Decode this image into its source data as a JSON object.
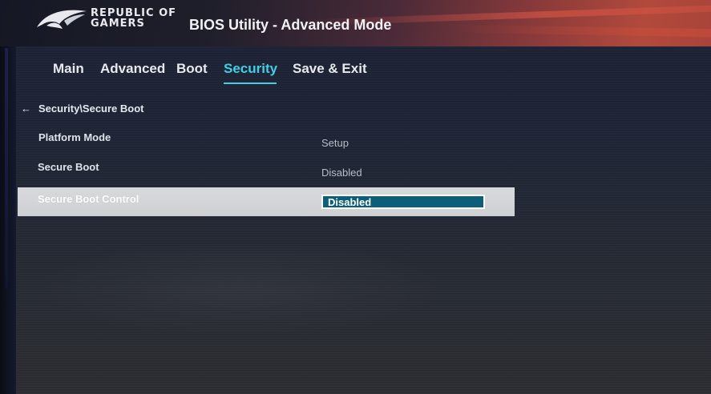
{
  "header": {
    "brand_line1": "REPUBLIC OF",
    "brand_line2": "GAMERS",
    "title": "BIOS Utility - Advanced Mode",
    "logo_icon": "rog-eye-logo-icon"
  },
  "tabs": [
    {
      "label": "Main",
      "active": false
    },
    {
      "label": "Advanced",
      "active": false
    },
    {
      "label": "Boot",
      "active": false
    },
    {
      "label": "Security",
      "active": true
    },
    {
      "label": "Save & Exit",
      "active": false
    }
  ],
  "breadcrumb": {
    "icon": "back-arrow-icon",
    "text": "Security\\Secure Boot"
  },
  "settings": [
    {
      "label": "Platform Mode",
      "value": "Setup"
    },
    {
      "label": "Secure Boot",
      "value": "Disabled"
    },
    {
      "label": "Secure Boot Control",
      "value": "Disabled",
      "selected": true
    }
  ],
  "colors": {
    "accent": "#3fd0e8",
    "dropdown_bg": "#0d5e78",
    "header_red": "#b24a3c"
  }
}
